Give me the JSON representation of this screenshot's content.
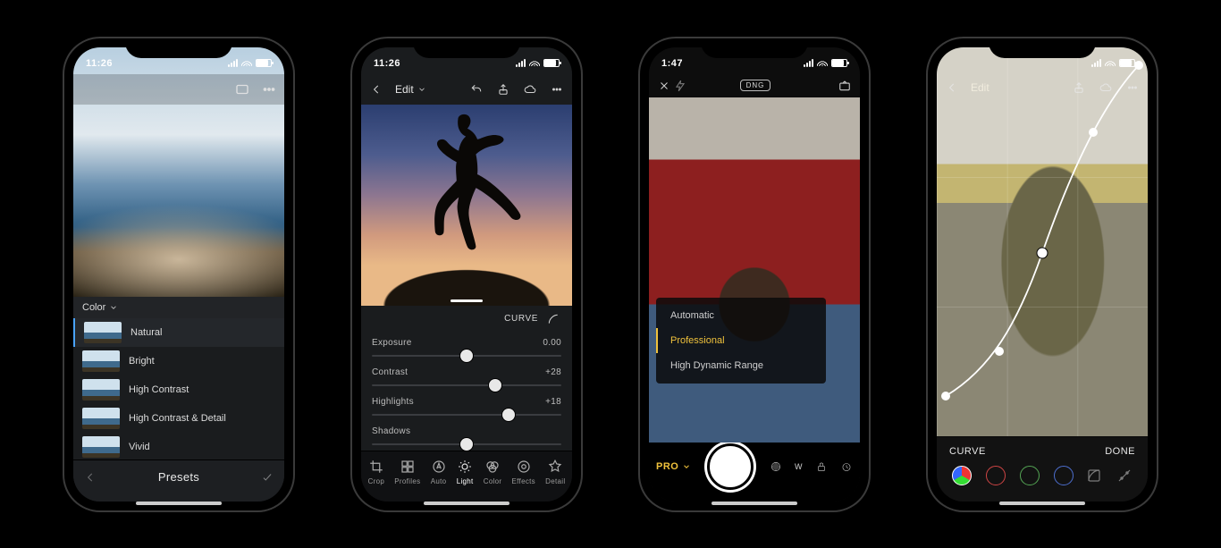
{
  "phone1": {
    "status_time": "11:26",
    "appbar_icons": [
      "aspect-icon",
      "more-icon"
    ],
    "presets": {
      "category_label": "Color",
      "items": [
        {
          "label": "Natural",
          "selected": true
        },
        {
          "label": "Bright",
          "selected": false
        },
        {
          "label": "High Contrast",
          "selected": false
        },
        {
          "label": "High Contrast & Detail",
          "selected": false
        },
        {
          "label": "Vivid",
          "selected": false
        }
      ],
      "footer_label": "Presets"
    }
  },
  "phone2": {
    "status_time": "11:26",
    "appbar_left": "Edit",
    "appbar_right_icons": [
      "undo-icon",
      "share-icon",
      "cloud-icon",
      "more-icon"
    ],
    "curve_label": "CURVE",
    "sliders": [
      {
        "name": "Exposure",
        "value": "0.00",
        "pos": 50
      },
      {
        "name": "Contrast",
        "value": "+28",
        "pos": 65
      },
      {
        "name": "Highlights",
        "value": "+18",
        "pos": 72
      },
      {
        "name": "Shadows",
        "value": "",
        "pos": 50
      }
    ],
    "tools": [
      {
        "label": "Crop",
        "icon": "crop"
      },
      {
        "label": "Profiles",
        "icon": "profiles"
      },
      {
        "label": "Auto",
        "icon": "auto"
      },
      {
        "label": "Light",
        "icon": "light",
        "active": true
      },
      {
        "label": "Color",
        "icon": "color"
      },
      {
        "label": "Effects",
        "icon": "fx"
      },
      {
        "label": "Detail",
        "icon": "detail"
      }
    ]
  },
  "phone3": {
    "status_time": "1:47",
    "format_label": "DNG",
    "modes": [
      {
        "label": "Automatic",
        "selected": false
      },
      {
        "label": "Professional",
        "selected": true
      },
      {
        "label": "High Dynamic Range",
        "selected": false
      }
    ],
    "mode_button": "PRO",
    "wb_label": "W"
  },
  "phone4": {
    "appbar_left": "Edit",
    "appbar_right_icons": [
      "share-icon",
      "cloud-icon",
      "more-icon"
    ],
    "curve_label": "CURVE",
    "done_label": "DONE",
    "channels": [
      "rgb",
      "r",
      "g",
      "b"
    ]
  }
}
